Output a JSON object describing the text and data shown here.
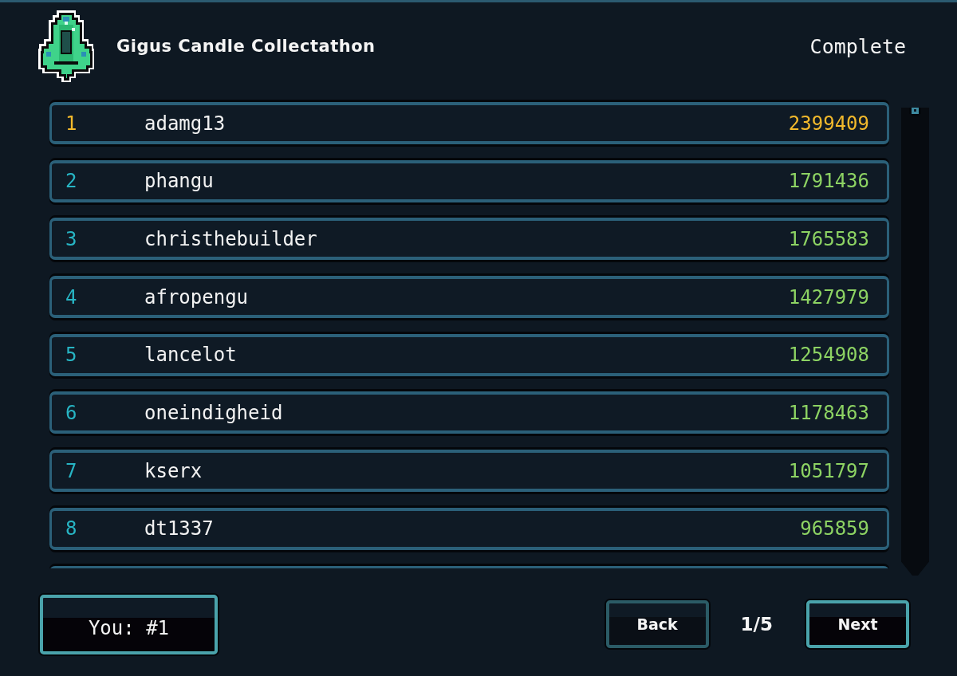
{
  "header": {
    "title": "Gigus Candle Collectathon",
    "status": "Complete"
  },
  "leaderboard": {
    "rows": [
      {
        "rank": "1",
        "name": "adamg13",
        "score": "2399409",
        "highlighted": true
      },
      {
        "rank": "2",
        "name": "phangu",
        "score": "1791436",
        "highlighted": false
      },
      {
        "rank": "3",
        "name": "christhebuilder",
        "score": "1765583",
        "highlighted": false
      },
      {
        "rank": "4",
        "name": "afropengu",
        "score": "1427979",
        "highlighted": false
      },
      {
        "rank": "5",
        "name": "lancelot",
        "score": "1254908",
        "highlighted": false
      },
      {
        "rank": "6",
        "name": "oneindigheid",
        "score": "1178463",
        "highlighted": false
      },
      {
        "rank": "7",
        "name": "kserx",
        "score": "1051797",
        "highlighted": false
      },
      {
        "rank": "8",
        "name": "dt1337",
        "score": "965859",
        "highlighted": false
      }
    ]
  },
  "footer": {
    "you_button": {
      "label": "You: #1"
    },
    "back_button": {
      "label": "Back",
      "disabled": true
    },
    "page_indicator": "1/5",
    "next_button": {
      "label": "Next",
      "disabled": false
    }
  }
}
